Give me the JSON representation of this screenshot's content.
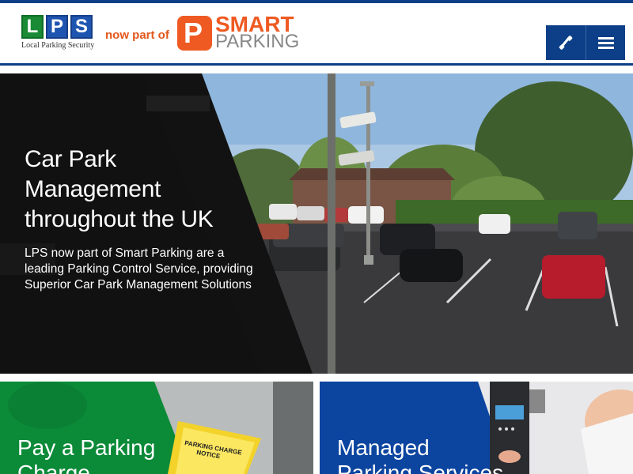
{
  "header": {
    "lps_letters": [
      "L",
      "P",
      "S"
    ],
    "lps_tagline": "Local Parking Security",
    "now_part_of": "now part of",
    "smart_parking_line1": "SMART",
    "smart_parking_line2": "PARKING",
    "phone_icon": "phone-icon",
    "menu_icon": "hamburger-menu-icon"
  },
  "hero": {
    "title_lines": [
      "Car Park",
      "Management",
      "throughout the UK"
    ],
    "subtitle": "LPS now part of Smart Parking are a leading Parking Control Service, providing Superior Car Park Management Solutions"
  },
  "cards": [
    {
      "title_line1": "Pay a Parking",
      "title_line2": "Charge",
      "photo_sign_line1": "PARKING CHARGE",
      "photo_sign_line2": "NOTICE",
      "color": "#0b8a38"
    },
    {
      "title_line1": "Managed",
      "title_line2": "Parking Services",
      "color": "#0c45a0"
    }
  ],
  "colors": {
    "brand_blue": "#0c3f87",
    "lps_green": "#1a8a34",
    "smart_orange": "#ef5a22"
  }
}
